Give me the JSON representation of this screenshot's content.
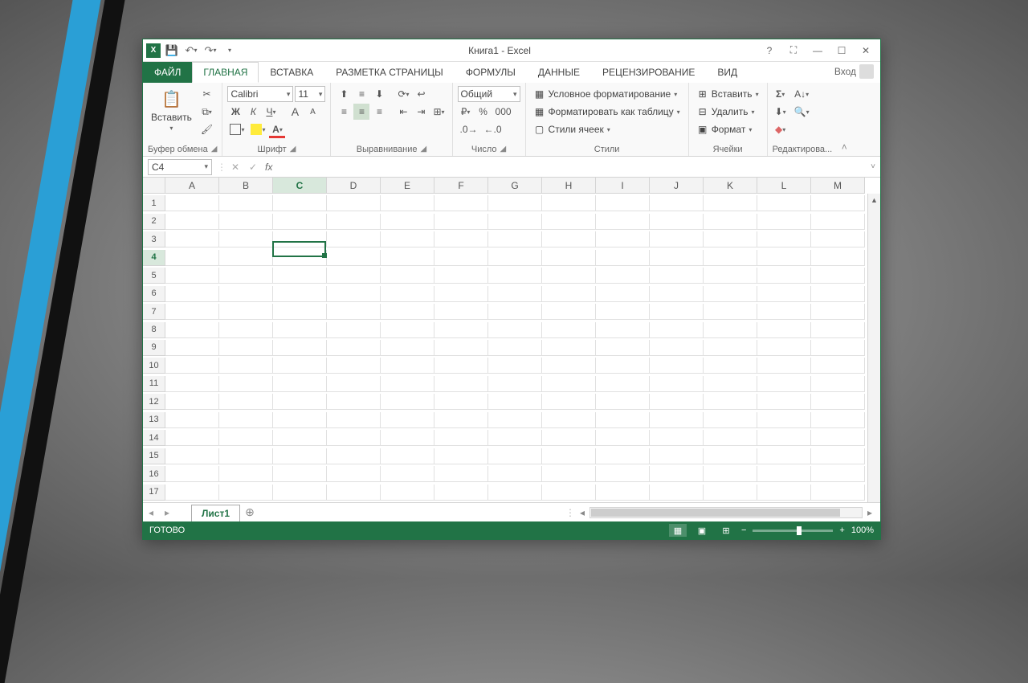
{
  "title": "Книга1 - Excel",
  "qat": {
    "save": "💾",
    "undo": "↶",
    "redo": "↷"
  },
  "win": {
    "help": "?",
    "opts": "⛶",
    "min": "—",
    "max": "☐",
    "close": "✕"
  },
  "tabs": {
    "file": "ФАЙЛ",
    "home": "ГЛАВНАЯ",
    "insert": "ВСТАВКА",
    "layout": "РАЗМЕТКА СТРАНИЦЫ",
    "formulas": "ФОРМУЛЫ",
    "data": "ДАННЫЕ",
    "review": "РЕЦЕНЗИРОВАНИЕ",
    "view": "ВИД",
    "signin": "Вход"
  },
  "ribbon": {
    "clipboard": {
      "paste": "Вставить",
      "label": "Буфер обмена"
    },
    "font": {
      "name": "Calibri",
      "size": "11",
      "bold": "Ж",
      "italic": "К",
      "underline": "Ч",
      "grow": "A",
      "shrink": "A",
      "label": "Шрифт",
      "color": "A"
    },
    "align": {
      "label": "Выравнивание"
    },
    "number": {
      "format": "Общий",
      "label": "Число",
      "percent": "%",
      "thousands": "000"
    },
    "styles": {
      "cond": "Условное форматирование",
      "table": "Форматировать как таблицу",
      "cell": "Стили ячеек",
      "label": "Стили"
    },
    "cells": {
      "insert": "Вставить",
      "delete": "Удалить",
      "format": "Формат",
      "label": "Ячейки"
    },
    "editing": {
      "sum": "Σ",
      "fill": "⬇",
      "clear": "◆",
      "sort": "A↓",
      "find": "🔍",
      "label": "Редактирова..."
    }
  },
  "formula": {
    "cellref": "C4",
    "fx": "fx",
    "value": ""
  },
  "columns": [
    "A",
    "B",
    "C",
    "D",
    "E",
    "F",
    "G",
    "H",
    "I",
    "J",
    "K",
    "L",
    "M"
  ],
  "rows": [
    "1",
    "2",
    "3",
    "4",
    "5",
    "6",
    "7",
    "8",
    "9",
    "10",
    "11",
    "12",
    "13",
    "14",
    "15",
    "16",
    "17"
  ],
  "selected": {
    "col": "C",
    "row": "4",
    "colIdx": 2,
    "rowIdx": 3
  },
  "sheet": {
    "name": "Лист1",
    "add": "⊕"
  },
  "status": {
    "ready": "ГОТОВО",
    "zoom": "100%"
  }
}
